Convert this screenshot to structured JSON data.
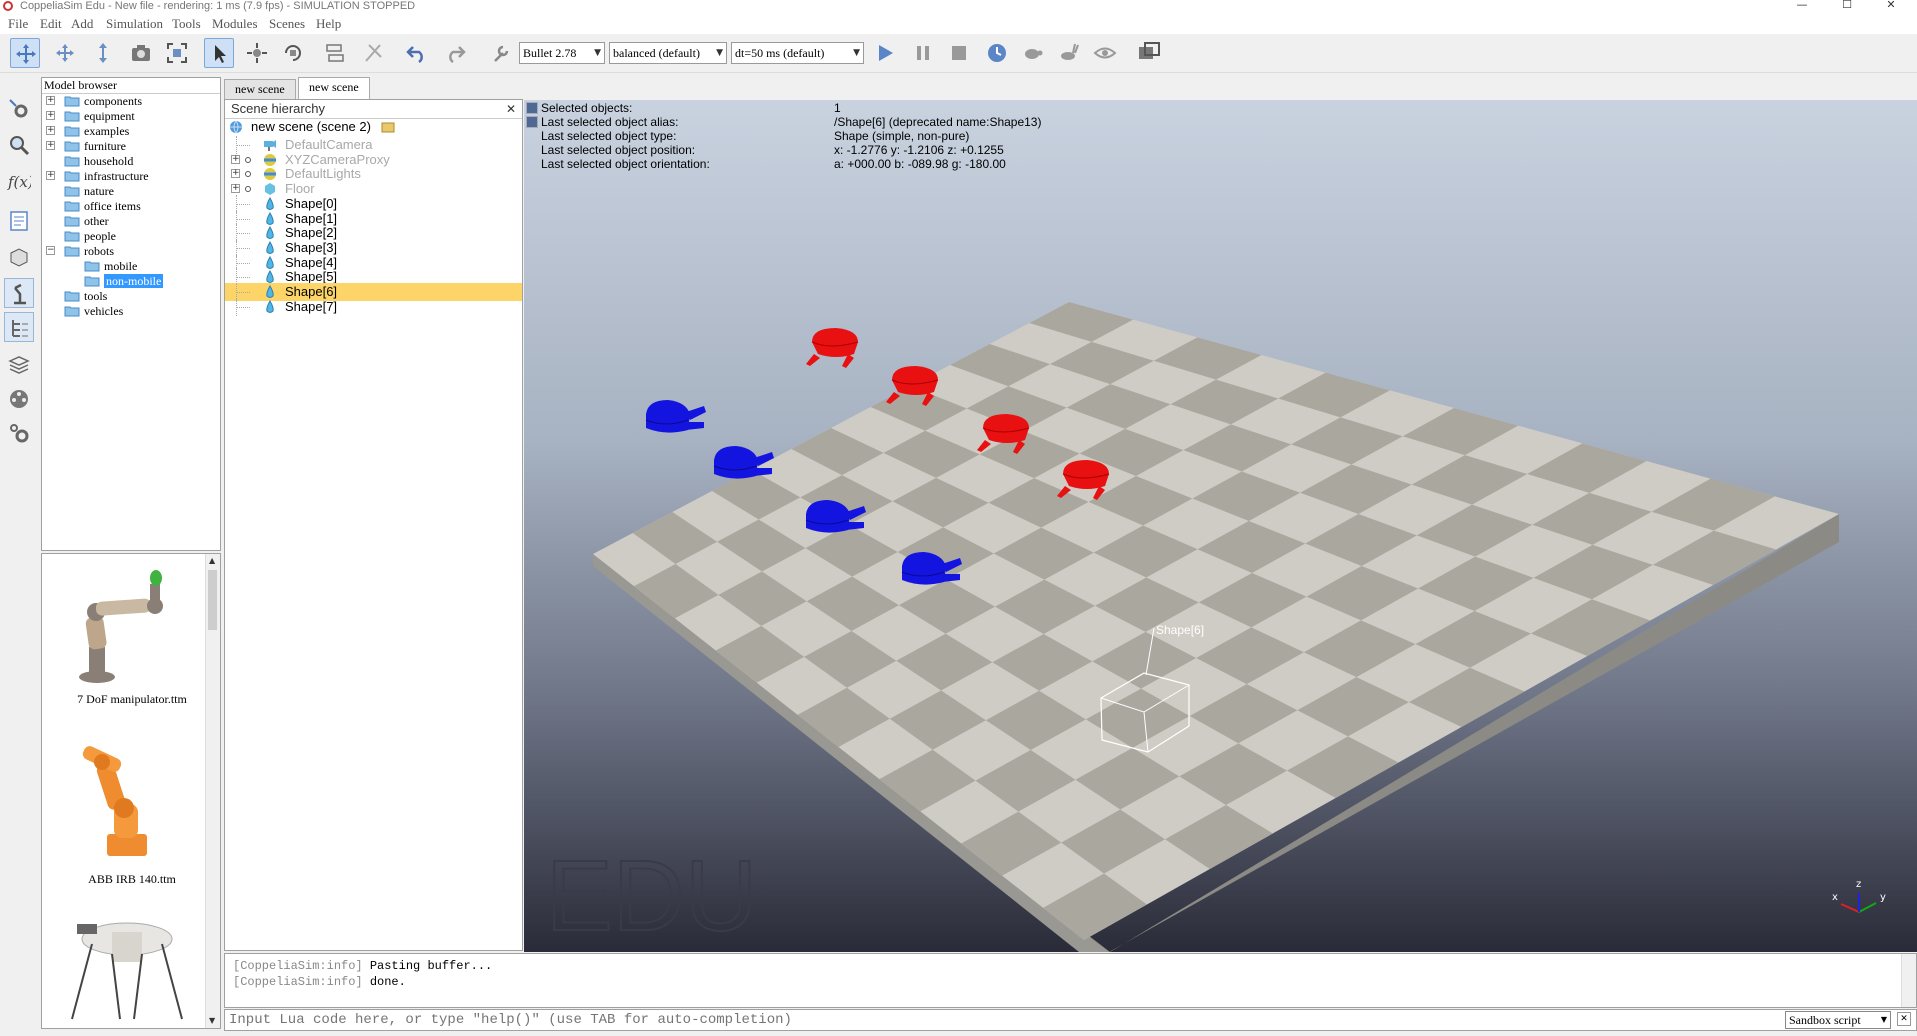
{
  "window": {
    "title": "CoppeliaSim Edu - New file - rendering: 1 ms (7.9 fps) - SIMULATION STOPPED",
    "minimize": "—",
    "maximize": "☐",
    "close": "✕"
  },
  "menu": [
    "File",
    "Edit",
    "Add",
    "Simulation",
    "Tools",
    "Modules",
    "Scenes",
    "Help"
  ],
  "toolbar": {
    "engine": "Bullet 2.78",
    "mode": "balanced (default)",
    "dt": "dt=50 ms (default)"
  },
  "model_browser": {
    "title": "Model browser",
    "items": [
      {
        "label": "components",
        "expandable": true
      },
      {
        "label": "equipment",
        "expandable": true
      },
      {
        "label": "examples",
        "expandable": true
      },
      {
        "label": "furniture",
        "expandable": true
      },
      {
        "label": "household",
        "expandable": false
      },
      {
        "label": "infrastructure",
        "expandable": true
      },
      {
        "label": "nature",
        "expandable": false
      },
      {
        "label": "office items",
        "expandable": false
      },
      {
        "label": "other",
        "expandable": false
      },
      {
        "label": "people",
        "expandable": false
      },
      {
        "label": "robots",
        "expandable": true
      },
      {
        "label": "mobile",
        "expandable": false
      },
      {
        "label": "non-mobile",
        "expandable": false
      },
      {
        "label": "tools",
        "expandable": false
      },
      {
        "label": "vehicles",
        "expandable": false
      }
    ],
    "thumbnails": [
      "7 DoF manipulator.ttm",
      "ABB IRB 140.ttm"
    ]
  },
  "tabs": [
    "new scene",
    "new scene"
  ],
  "hierarchy": {
    "title": "Scene hierarchy",
    "close": "✕",
    "root": "new scene (scene 2)",
    "items": [
      {
        "label": "DefaultCamera",
        "kind": "camera",
        "dimmed": true
      },
      {
        "label": "XYZCameraProxy",
        "kind": "dummy",
        "dimmed": true
      },
      {
        "label": "DefaultLights",
        "kind": "light",
        "dimmed": true
      },
      {
        "label": "Floor",
        "kind": "floor",
        "dimmed": true
      },
      {
        "label": "Shape[0]",
        "kind": "shape",
        "dimmed": false
      },
      {
        "label": "Shape[1]",
        "kind": "shape",
        "dimmed": false
      },
      {
        "label": "Shape[2]",
        "kind": "shape",
        "dimmed": false
      },
      {
        "label": "Shape[3]",
        "kind": "shape",
        "dimmed": false
      },
      {
        "label": "Shape[4]",
        "kind": "shape",
        "dimmed": false
      },
      {
        "label": "Shape[5]",
        "kind": "shape",
        "dimmed": false
      },
      {
        "label": "Shape[6]",
        "kind": "shape",
        "dimmed": false
      },
      {
        "label": "Shape[7]",
        "kind": "shape",
        "dimmed": false
      }
    ]
  },
  "info": {
    "labels": [
      "Selected objects:",
      "Last selected object alias:",
      "Last selected object type:",
      "Last selected object position:",
      "Last selected object orientation:"
    ],
    "values": [
      "1",
      "/Shape[6]    (deprecated name:Shape13)",
      "Shape (simple, non-pure)",
      "x: -1.2776    y: -1.2106    z: +0.1255",
      "a: +000.00    b: -089.98    g: -180.00"
    ]
  },
  "viewport": {
    "selected_label": "Shape[6]",
    "watermark": "EDU",
    "axis_labels": {
      "x": "x",
      "y": "y",
      "z": "z"
    },
    "red_color": "#e81010",
    "blue_color": "#1414e0"
  },
  "console": {
    "lines": [
      {
        "prefix": "[CoppeliaSim:info]",
        "text": "Pasting buffer..."
      },
      {
        "prefix": "[CoppeliaSim:info]",
        "text": "done."
      }
    ],
    "input_placeholder": "Input Lua code here, or type \"help()\" (use TAB for auto-completion)",
    "script_selector": "Sandbox script",
    "close": "✕"
  }
}
